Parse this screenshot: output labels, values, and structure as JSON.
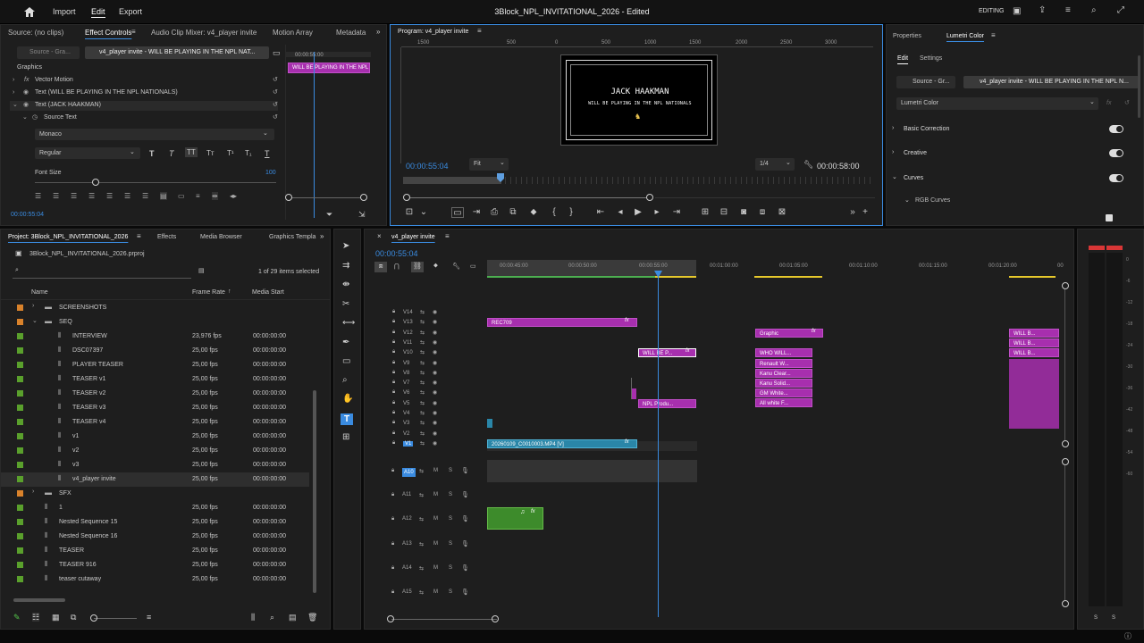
{
  "titlebar": {
    "menu": [
      "Import",
      "Edit",
      "Export"
    ],
    "active_menu": "Edit",
    "title": "3Block_NPL_INVITATIONAL_2026 - Edited",
    "workspace": "EDITING"
  },
  "effect_controls": {
    "tabs": [
      "Source: (no clips)",
      "Effect Controls",
      "Audio Clip Mixer: v4_player invite",
      "Motion Array",
      "Metadata"
    ],
    "source": "Source - Gra...",
    "clip": "v4_player invite - WILL BE PLAYING IN THE NPL NAT...",
    "mini_time": "00:00:55:00",
    "mini_clip": "WILL BE PLAYING IN THE NPL NATIONALS",
    "section": "Graphics",
    "items": [
      "Vector Motion",
      "Text (WILL BE PLAYING IN THE NPL NATIONALS)",
      "Text (JACK HAAKMAN)",
      "Source Text"
    ],
    "font": "Monaco",
    "style": "Regular",
    "font_size_label": "Font Size",
    "font_size_value": "100",
    "timecode": "00:00:55:04"
  },
  "program": {
    "title": "Program: v4_player invite",
    "ruler": [
      "1500",
      "500",
      "0",
      "500",
      "1000",
      "1500",
      "2000",
      "2500",
      "3000"
    ],
    "line1": "JACK HAAKMAN",
    "line2": "WILL BE PLAYING IN THE NPL NATIONALS",
    "timecode": "00:00:55:04",
    "fit": "Fit",
    "quality": "1/4",
    "duration": "00:00:58:00"
  },
  "lumetri": {
    "tabs": [
      "Properties",
      "Lumetri Color"
    ],
    "subtabs": [
      "Edit",
      "Settings"
    ],
    "source": "Source - Gr...",
    "clip": "v4_player invite - WILL BE PLAYING IN THE NPL N...",
    "dropdown": "Lumetri Color",
    "sections": [
      "Basic Correction",
      "Creative",
      "Curves"
    ],
    "sub": "RGB Curves"
  },
  "project": {
    "tabs": [
      "Project: 3Block_NPL_INVITATIONAL_2026",
      "Effects",
      "Media Browser",
      "Graphics Templa"
    ],
    "file": "3Block_NPL_INVITATIONAL_2026.prproj",
    "selection": "1 of 29 items selected",
    "columns": [
      "Name",
      "Frame Rate",
      "Media Start"
    ],
    "items": [
      {
        "name": "SCREENSHOTS",
        "fps": "",
        "start": "",
        "type": "folder",
        "color": "#d9822b",
        "indent": 1
      },
      {
        "name": "SEQ",
        "fps": "",
        "start": "",
        "type": "folder",
        "color": "#d9822b",
        "indent": 1
      },
      {
        "name": "INTERVIEW",
        "fps": "23,976 fps",
        "start": "00:00:00:00",
        "type": "seq",
        "color": "#5aa02c",
        "indent": 2
      },
      {
        "name": "DSC07397",
        "fps": "25,00 fps",
        "start": "00:00:00:00",
        "type": "seq",
        "color": "#5aa02c",
        "indent": 2
      },
      {
        "name": "PLAYER TEASER",
        "fps": "25,00 fps",
        "start": "00:00:00:00",
        "type": "seq",
        "color": "#5aa02c",
        "indent": 2
      },
      {
        "name": "TEASER v1",
        "fps": "25,00 fps",
        "start": "00:00:00:00",
        "type": "seq",
        "color": "#5aa02c",
        "indent": 2
      },
      {
        "name": "TEASER v2",
        "fps": "25,00 fps",
        "start": "00:00:00:00",
        "type": "seq",
        "color": "#5aa02c",
        "indent": 2
      },
      {
        "name": "TEASER v3",
        "fps": "25,00 fps",
        "start": "00:00:00:00",
        "type": "seq",
        "color": "#5aa02c",
        "indent": 2
      },
      {
        "name": "TEASER v4",
        "fps": "25,00 fps",
        "start": "00:00:00:00",
        "type": "seq",
        "color": "#5aa02c",
        "indent": 2
      },
      {
        "name": "v1",
        "fps": "25,00 fps",
        "start": "00:00:00:00",
        "type": "seq",
        "color": "#5aa02c",
        "indent": 2
      },
      {
        "name": "v2",
        "fps": "25,00 fps",
        "start": "00:00:00:00",
        "type": "seq",
        "color": "#5aa02c",
        "indent": 2
      },
      {
        "name": "v3",
        "fps": "25,00 fps",
        "start": "00:00:00:00",
        "type": "seq",
        "color": "#5aa02c",
        "indent": 2
      },
      {
        "name": "v4_player invite",
        "fps": "25,00 fps",
        "start": "00:00:00:00",
        "type": "seq",
        "color": "#5aa02c",
        "indent": 2,
        "selected": true
      },
      {
        "name": "SFX",
        "fps": "",
        "start": "",
        "type": "folder",
        "color": "#d9822b",
        "indent": 1
      },
      {
        "name": "1",
        "fps": "25,00 fps",
        "start": "00:00:00:00",
        "type": "seq",
        "color": "#5aa02c",
        "indent": 1
      },
      {
        "name": "Nested Sequence 15",
        "fps": "25,00 fps",
        "start": "00:00:00:00",
        "type": "seq",
        "color": "#5aa02c",
        "indent": 1
      },
      {
        "name": "Nested Sequence 16",
        "fps": "25,00 fps",
        "start": "00:00:00:00",
        "type": "seq",
        "color": "#5aa02c",
        "indent": 1
      },
      {
        "name": "TEASER",
        "fps": "25,00 fps",
        "start": "00:00:00:00",
        "type": "seq",
        "color": "#5aa02c",
        "indent": 1
      },
      {
        "name": "TEASER 916",
        "fps": "25,00 fps",
        "start": "00:00:00:00",
        "type": "seq",
        "color": "#5aa02c",
        "indent": 1
      },
      {
        "name": "teaser cutaway",
        "fps": "25,00 fps",
        "start": "00:00:00:00",
        "type": "seq",
        "color": "#5aa02c",
        "indent": 1
      }
    ]
  },
  "timeline": {
    "tab": "v4_player invite",
    "timecode": "00:00:55:04",
    "ruler": [
      "00:00:45:00",
      "00:00:50:00",
      "00:00:55:00",
      "00:01:00:00",
      "00:01:05:00",
      "00:01:10:00",
      "00:01:15:00",
      "00:01:20:00",
      "00"
    ],
    "video_tracks": [
      "V14",
      "V13",
      "V12",
      "V11",
      "V10",
      "V9",
      "V8",
      "V7",
      "V6",
      "V5",
      "V4",
      "V3",
      "V2",
      "V1"
    ],
    "audio_tracks": [
      "A10",
      "A11",
      "A12",
      "A13",
      "A14",
      "A15"
    ],
    "clips": {
      "rec": "REC709",
      "graphic": "Graphic",
      "willbe": "WILL BE P...",
      "who": "WHO WILL...",
      "renault": "Renault W...",
      "kanu1": "Kanu Clear...",
      "kanu2": "Kanu Solid...",
      "gm": "GM White...",
      "allwhite": "All white F...",
      "npl": "NPL Produ...",
      "will1": "WILL B...",
      "will2": "WILL B...",
      "will3": "WILL B...",
      "video": "20260109_C0010003.MP4 [V]"
    }
  }
}
